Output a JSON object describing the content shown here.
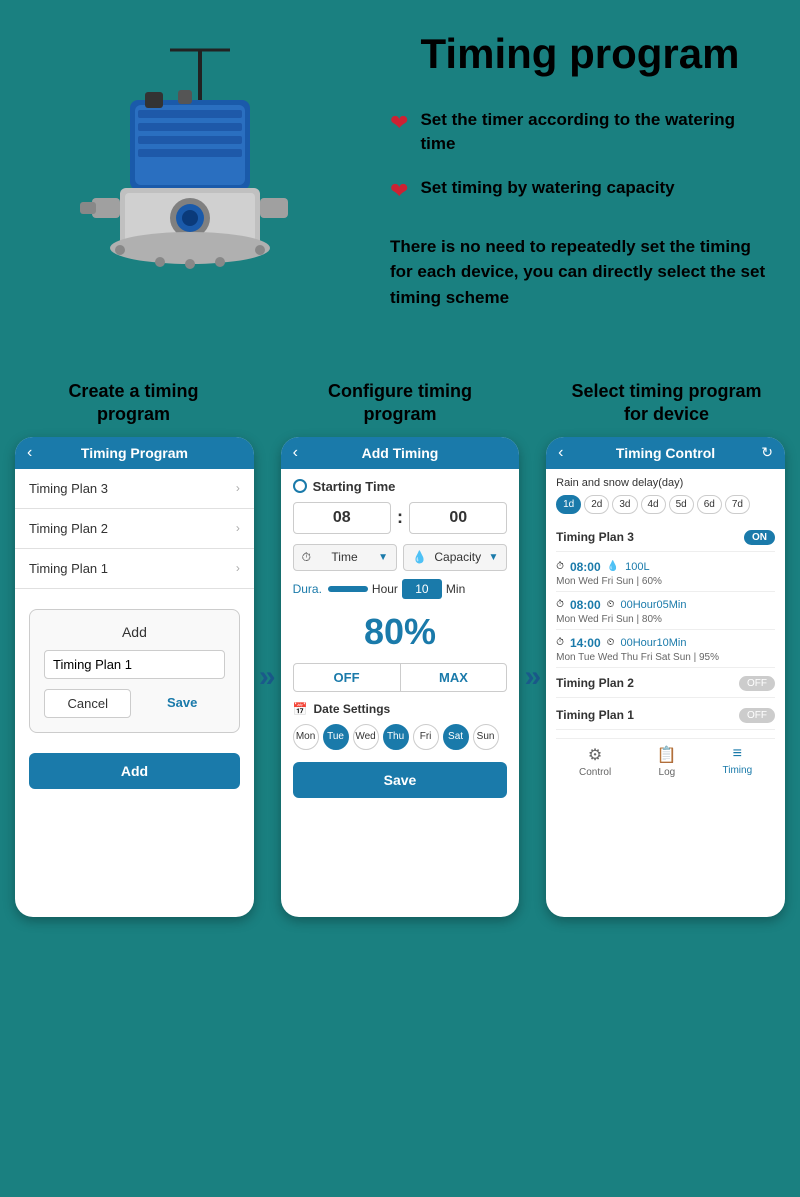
{
  "page": {
    "title": "Timing program",
    "background_color": "#1a8080"
  },
  "top_section": {
    "bullets": [
      {
        "id": "bullet1",
        "text": "Set the timer according to the watering time"
      },
      {
        "id": "bullet2",
        "text": "Set timing by watering capacity"
      }
    ],
    "description": "There is no need to repeatedly set the timing for each device, you can directly select the set timing scheme"
  },
  "bottom_section": {
    "phones": [
      {
        "id": "phone1",
        "header": "Create a timing\nprogram",
        "screen_title": "Timing Program",
        "list_items": [
          "Timing Plan 3",
          "Timing Plan 2",
          "Timing Plan 1"
        ],
        "modal_add_label": "Add",
        "modal_input_value": "Timing Plan 1",
        "modal_cancel_label": "Cancel",
        "modal_save_label": "Save",
        "add_button_label": "Add"
      },
      {
        "id": "phone2",
        "header": "Configure timing\nprogram",
        "screen_title": "Add Timing",
        "starting_time_label": "Starting Time",
        "hour_value": "08",
        "minute_value": "00",
        "time_label": "Time",
        "capacity_label": "Capacity",
        "dura_label": "Dura.",
        "hour_label": "Hour",
        "min_value": "10",
        "min_label": "Min",
        "percent_value": "80%",
        "off_label": "OFF",
        "max_label": "MAX",
        "date_settings_label": "Date Settings",
        "days": [
          {
            "label": "Mon",
            "active": false
          },
          {
            "label": "Tue",
            "active": true
          },
          {
            "label": "Wed",
            "active": false
          },
          {
            "label": "Thu",
            "active": true
          },
          {
            "label": "Fri",
            "active": false
          },
          {
            "label": "Sat",
            "active": true
          },
          {
            "label": "Sun",
            "active": false
          }
        ],
        "save_label": "Save"
      },
      {
        "id": "phone3",
        "header": "Select timing program\nfor device",
        "screen_title": "Timing Control",
        "rain_snow_label": "Rain and snow delay(day)",
        "day_pills": [
          {
            "label": "1d",
            "active": true
          },
          {
            "label": "2d",
            "active": false
          },
          {
            "label": "3d",
            "active": false
          },
          {
            "label": "4d",
            "active": false
          },
          {
            "label": "5d",
            "active": false
          },
          {
            "label": "6d",
            "active": false
          },
          {
            "label": "7d",
            "active": false
          }
        ],
        "plans": [
          {
            "name": "Timing Plan 3",
            "toggle": "ON",
            "schedules": [
              {
                "time": "08:00",
                "detail": "100L",
                "days": "Mon Wed Fri Sun | 60%"
              },
              {
                "time": "08:00",
                "detail": "00Hour05Min",
                "days": "Mon Wed Fri Sun | 80%"
              },
              {
                "time": "14:00",
                "detail": "00Hour10Min",
                "days": "Mon Tue Wed Thu Fri Sat Sun | 95%"
              }
            ]
          },
          {
            "name": "Timing Plan 2",
            "toggle": "OFF"
          },
          {
            "name": "Timing Plan 1",
            "toggle": "OFF"
          }
        ],
        "bottom_nav": [
          {
            "label": "Control",
            "icon": "⚙",
            "active": false
          },
          {
            "label": "Log",
            "icon": "📋",
            "active": false
          },
          {
            "label": "Timing",
            "icon": "≡",
            "active": true
          }
        ]
      }
    ]
  }
}
